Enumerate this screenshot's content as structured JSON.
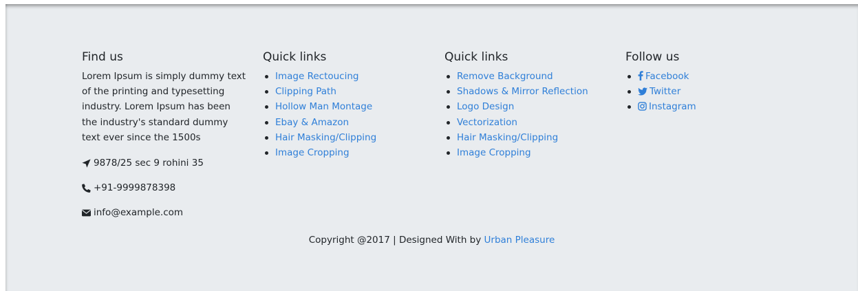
{
  "find_us": {
    "heading": "Find us",
    "about": "Lorem Ipsum is simply dummy text of the printing and typesetting industry. Lorem Ipsum has been the industry's standard dummy text ever since the 1500s",
    "address": "9878/25 sec 9 rohini 35",
    "phone": "+91-9999878398",
    "email": "info@example.com",
    "icons": [
      "location-arrow-icon",
      "phone-icon",
      "envelope-icon"
    ]
  },
  "quick_links_1": {
    "heading": "Quick links",
    "items": [
      "Image Rectoucing",
      "Clipping Path",
      "Hollow Man Montage",
      "Ebay & Amazon",
      "Hair Masking/Clipping",
      "Image Cropping"
    ]
  },
  "quick_links_2": {
    "heading": "Quick links",
    "items": [
      "Remove Background",
      "Shadows & Mirror Reflection",
      "Logo Design",
      "Vectorization",
      "Hair Masking/Clipping",
      "Image Cropping"
    ]
  },
  "follow_us": {
    "heading": "Follow us",
    "items": [
      {
        "label": "Facebook",
        "icon": "facebook-icon"
      },
      {
        "label": "Twitter",
        "icon": "twitter-icon"
      },
      {
        "label": "Instagram",
        "icon": "instagram-icon"
      }
    ]
  },
  "copyright": {
    "text": "Copyright @2017 | Designed With by",
    "link": "Urban Pleasure"
  },
  "colors": {
    "background": "#e9ecef",
    "link": "#2f7fd8",
    "text": "#212529"
  }
}
